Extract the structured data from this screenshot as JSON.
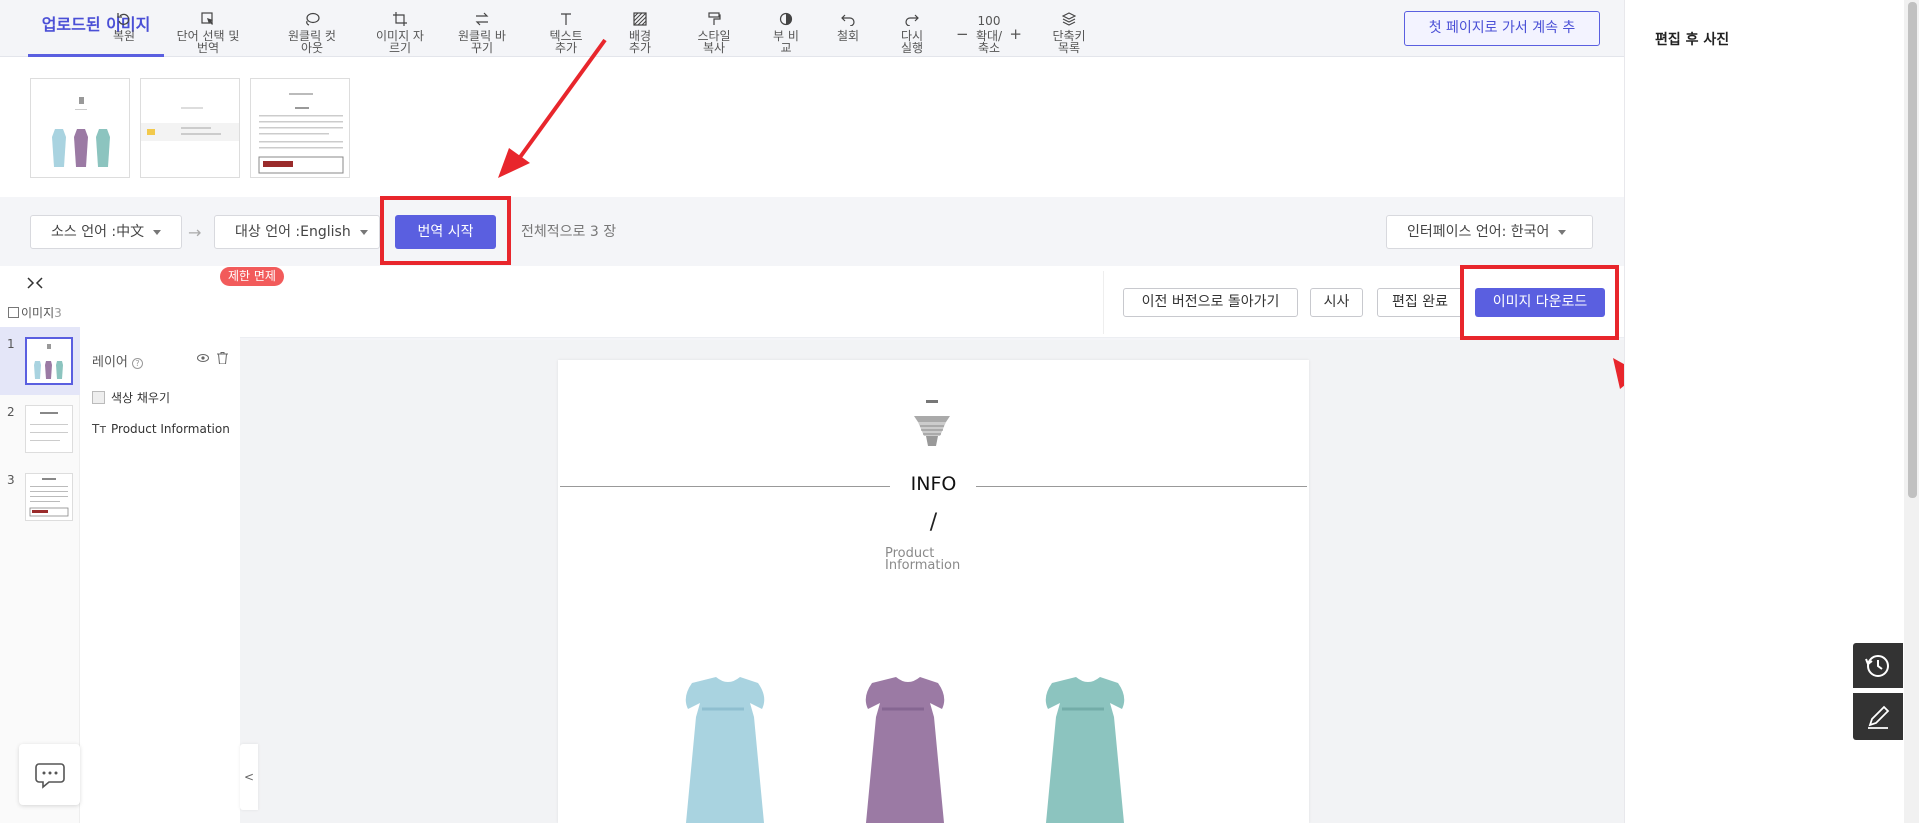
{
  "tabs": {
    "uploaded": "업로드된 이미지"
  },
  "header": {
    "first_page_button": "첫 페이지로 가서 계속 추"
  },
  "lang": {
    "source": "소스 언어 :中文",
    "target": "대상 언어 :English",
    "translate_button": "번역 시작",
    "total_text": "전체적으로 3 장",
    "interface": "인터페이스 언어: 한국어"
  },
  "toolbar": {
    "free_badge": "제한 면제",
    "tools": [
      {
        "icon": "undo-restore-icon",
        "label1": "복원",
        "label2": ""
      },
      {
        "icon": "cursor-select-icon",
        "label1": "단어 선택 및",
        "label2": "번역"
      },
      {
        "icon": "lasso-cutout-icon",
        "label1": "원클릭 컷",
        "label2": "아웃"
      },
      {
        "icon": "crop-icon",
        "label1": "이미지 자",
        "label2": "르기"
      },
      {
        "icon": "swap-icon",
        "label1": "원클릭 바",
        "label2": "꾸기"
      },
      {
        "icon": "text-icon",
        "label1": "텍스트",
        "label2": "추가"
      },
      {
        "icon": "background-icon",
        "label1": "배경",
        "label2": "추가"
      },
      {
        "icon": "paint-roller-icon",
        "label1": "스타일",
        "label2": "복사"
      },
      {
        "icon": "compare-icon",
        "label1": "부 비",
        "label2": "교"
      },
      {
        "icon": "undo-icon",
        "label1": "철회",
        "label2": ""
      },
      {
        "icon": "redo-icon",
        "label1": "다시",
        "label2": "실행"
      },
      {
        "icon": "zoom-icon",
        "label1": "100",
        "label2": "확대/",
        "label3": "축소"
      },
      {
        "icon": "shortcut-icon",
        "label1": "단축키",
        "label2": "목록"
      }
    ],
    "revert_button": "이전 버전으로 돌아가기",
    "preview_button": "시사",
    "done_button": "편집 완료",
    "download_button": "이미지 다운로드"
  },
  "sidebar": {
    "images_label": "이미지",
    "images_count": "3",
    "pages": [
      "1",
      "2",
      "3"
    ]
  },
  "layers": {
    "title": "레이어",
    "items": [
      {
        "icon": "checkbox-icon",
        "label": "색상 채우기"
      },
      {
        "icon": "text-type-icon",
        "label": "Product Information"
      }
    ]
  },
  "canvas": {
    "title": "INFO",
    "slash": "/",
    "subtitle1": "Product",
    "subtitle2": "Information"
  },
  "right_panel": {
    "title": "편집 후 사진"
  },
  "colors": {
    "accent": "#5a5fe0",
    "highlight": "#e8262c",
    "badge": "#f25b5b"
  }
}
